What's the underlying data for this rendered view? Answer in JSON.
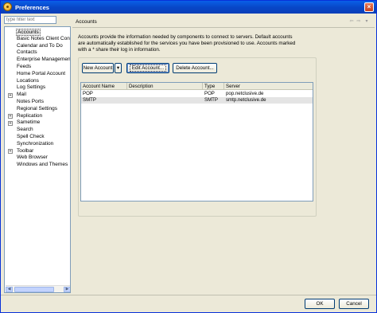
{
  "window": {
    "title": "Preferences",
    "close_glyph": "×"
  },
  "sidebar": {
    "filter_placeholder": "type filter text",
    "items": [
      {
        "label": "Accounts",
        "expandable": false,
        "selected": true
      },
      {
        "label": "Basic Notes Client Configuration",
        "expandable": false
      },
      {
        "label": "Calendar and To Do",
        "expandable": false
      },
      {
        "label": "Contacts",
        "expandable": false
      },
      {
        "label": "Enterprise Management Agent",
        "expandable": false
      },
      {
        "label": "Feeds",
        "expandable": false
      },
      {
        "label": "Home Portal Account",
        "expandable": false
      },
      {
        "label": "Locations",
        "expandable": false
      },
      {
        "label": "Log Settings",
        "expandable": false
      },
      {
        "label": "Mail",
        "expandable": true
      },
      {
        "label": "Notes Ports",
        "expandable": false
      },
      {
        "label": "Regional Settings",
        "expandable": false
      },
      {
        "label": "Replication",
        "expandable": true
      },
      {
        "label": "Sametime",
        "expandable": true
      },
      {
        "label": "Search",
        "expandable": false
      },
      {
        "label": "Spell Check",
        "expandable": false
      },
      {
        "label": "Synchronization",
        "expandable": false
      },
      {
        "label": "Toolbar",
        "expandable": true
      },
      {
        "label": "Web Browser",
        "expandable": false
      },
      {
        "label": "Windows and Themes",
        "expandable": false
      }
    ]
  },
  "main": {
    "title": "Accounts",
    "nav": {
      "back": "⇦",
      "forward": "⇨",
      "menu": "▾"
    },
    "description": "Accounts provide the information needed by components to connect to servers.  Default accounts are automatically established for the services you have been provisioned to use.  Accounts marked with a * share their log in information.",
    "buttons": {
      "new_account": "New Account",
      "new_account_arrow": "▾",
      "edit_account": "Edit Account...",
      "delete_account": "Delete Account..."
    },
    "table": {
      "columns": [
        "Account Name",
        "Description",
        "Type",
        "Server"
      ],
      "rows": [
        {
          "name": "POP",
          "description": "",
          "type": "POP",
          "server": "pop.netclusive.de"
        },
        {
          "name": "SMTP",
          "description": "",
          "type": "SMTP",
          "server": "smtp.netclusive.de"
        }
      ]
    }
  },
  "footer": {
    "ok": "OK",
    "cancel": "Cancel"
  }
}
